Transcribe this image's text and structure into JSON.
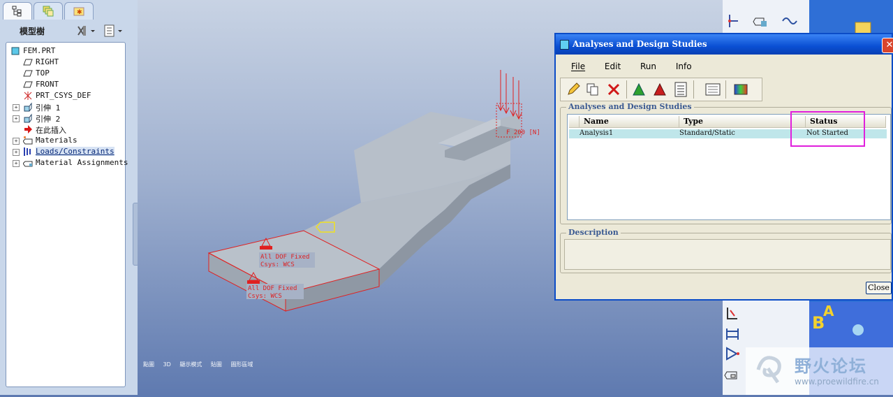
{
  "left_panel": {
    "tree_title": "模型樹",
    "items": [
      {
        "label": "FEM.PRT",
        "icon": "part-icon",
        "expandable": false
      },
      {
        "label": "RIGHT",
        "icon": "datum-plane-icon",
        "expandable": false
      },
      {
        "label": "TOP",
        "icon": "datum-plane-icon",
        "expandable": false
      },
      {
        "label": "FRONT",
        "icon": "datum-plane-icon",
        "expandable": false
      },
      {
        "label": "PRT_CSYS_DEF",
        "icon": "csys-icon",
        "expandable": false
      },
      {
        "label": "引伸 1",
        "icon": "extrude-icon",
        "expandable": true
      },
      {
        "label": "引伸 2",
        "icon": "extrude-icon",
        "expandable": true
      },
      {
        "label": "在此插入",
        "icon": "insert-arrow-icon",
        "expandable": false
      },
      {
        "label": "Materials",
        "icon": "materials-icon",
        "expandable": true
      },
      {
        "label": "Loads/Constraints",
        "icon": "loads-icon",
        "expandable": true,
        "selected": true
      },
      {
        "label": "Material Assignments",
        "icon": "material-assign-icon",
        "expandable": true
      }
    ]
  },
  "viewport": {
    "annotations": {
      "constraint_1_line1": "All DOF Fixed",
      "constraint_1_line2": "Csys: WCS",
      "constraint_2_line1": "All DOF Fixed",
      "constraint_2_line2": "Csys: WCS",
      "load_label": "F 200 [N]"
    },
    "status_items": [
      "點圖",
      "3D",
      "顯示模式",
      "貼圖",
      "圖形區域"
    ]
  },
  "dialog": {
    "title": "Analyses and Design Studies",
    "menu": [
      "File",
      "Edit",
      "Run",
      "Info"
    ],
    "studies_group_label": "Analyses and Design Studies",
    "columns": [
      "Name",
      "Type",
      "Status"
    ],
    "rows": [
      {
        "name": "Analysis1",
        "type": "Standard/Static",
        "status": "Not Started"
      }
    ],
    "description_label": "Description",
    "description_value": "",
    "close_label": "Close"
  },
  "watermark": {
    "text": "野火论坛",
    "url": "www.proewildfire.cn"
  },
  "colors": {
    "highlight": "#e01fdc",
    "titlebar": "#0a4fd3",
    "constraint": "#e02020"
  }
}
